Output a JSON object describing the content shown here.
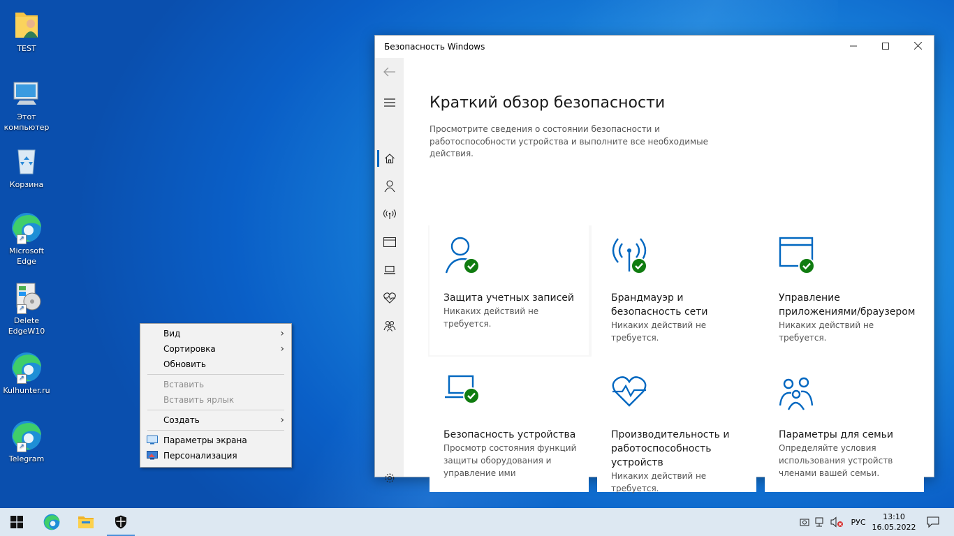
{
  "desktop": {
    "icons": [
      {
        "label_line1": "TEST",
        "label_line2": ""
      },
      {
        "label_line1": "Этот",
        "label_line2": "компьютер"
      },
      {
        "label_line1": "Корзина",
        "label_line2": ""
      },
      {
        "label_line1": "Microsoft",
        "label_line2": "Edge"
      },
      {
        "label_line1": "Delete",
        "label_line2": "EdgeW10"
      },
      {
        "label_line1": "Kulhunter.ru",
        "label_line2": ""
      },
      {
        "label_line1": "Telegram",
        "label_line2": ""
      }
    ]
  },
  "context_menu": {
    "view": "Вид",
    "sort": "Сортировка",
    "refresh": "Обновить",
    "paste": "Вставить",
    "paste_shortcut": "Вставить ярлык",
    "create": "Создать",
    "display_settings": "Параметры экрана",
    "personalize": "Персонализация"
  },
  "window": {
    "title": "Безопасность Windows",
    "heading": "Краткий обзор безопасности",
    "description": "Просмотрите сведения о состоянии безопасности и работоспособности устройства и выполните все необходимые действия.",
    "tiles": [
      {
        "title": "Защита учетных записей",
        "status": "Никаких действий не требуется."
      },
      {
        "title": "Брандмауэр и безопасность сети",
        "status": "Никаких действий не требуется."
      },
      {
        "title": "Управление приложениями/браузером",
        "status": "Никаких действий не требуется."
      },
      {
        "title": "Безопасность устройства",
        "status": "Просмотр состояния функций защиты оборудования и управление ими"
      },
      {
        "title": "Производительность и работоспособность устройств",
        "status": "Никаких действий не требуется."
      },
      {
        "title": "Параметры для семьи",
        "status": "Определяйте условия использования устройств членами вашей семьи."
      }
    ]
  },
  "taskbar": {
    "language": "РУС",
    "time": "13:10",
    "date": "16.05.2022"
  },
  "colors": {
    "accent": "#0067c0",
    "ok_green": "#107c10"
  }
}
